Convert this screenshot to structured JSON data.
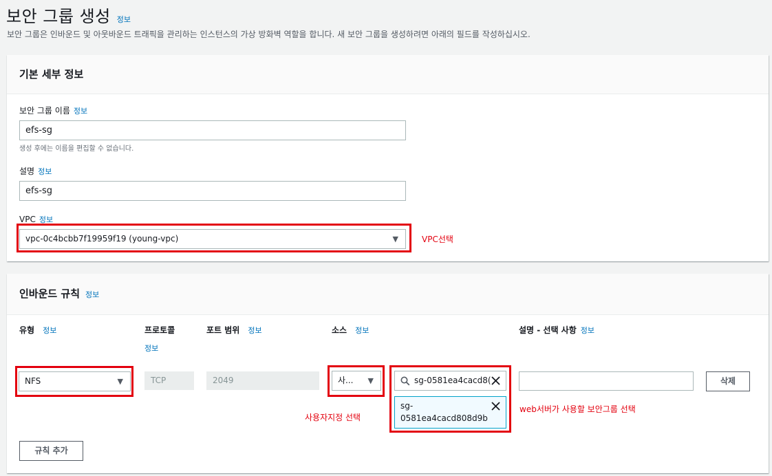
{
  "page": {
    "title": "보안 그룹 생성",
    "info": "정보",
    "description": "보안 그룹은 인바운드 및 아웃바운드 트래픽을 관리하는 인스턴스의 가상 방화벽 역할을 합니다. 새 보안 그룹을 생성하려면 아래의 필드를 작성하십시오."
  },
  "basic": {
    "header": "기본 세부 정보",
    "name_label": "보안 그룹 이름",
    "name_info": "정보",
    "name_value": "efs-sg",
    "name_hint": "생성 후에는 이름을 편집할 수 없습니다.",
    "desc_label": "설명",
    "desc_info": "정보",
    "desc_value": "efs-sg",
    "vpc_label": "VPC",
    "vpc_info": "정보",
    "vpc_value": "vpc-0c4bcbb7f19959f19 (young-vpc)",
    "vpc_annotation": "VPC선택"
  },
  "inbound": {
    "header": "인바운드 규칙",
    "header_info": "정보",
    "columns": {
      "type": "유형",
      "type_info": "정보",
      "protocol": "프로토콜",
      "protocol_info": "정보",
      "port": "포트 범위",
      "port_info": "정보",
      "source": "소스",
      "source_info": "정보",
      "desc": "설명 - 선택 사항",
      "desc_info": "정보"
    },
    "rule": {
      "type": "NFS",
      "protocol": "TCP",
      "port": "2049",
      "source": "사...",
      "search_value": "sg-0581ea4cacd8(",
      "token": "sg-0581ea4cacd808d9b",
      "delete_label": "삭제"
    },
    "source_annotation": "사용자지정 선택",
    "sg_annotation": "web서버가 사용할 보안그룹 선택",
    "add_rule_label": "규칙 추가"
  },
  "colors": {
    "accent": "#0073bb",
    "annotation": "#e3000e"
  }
}
